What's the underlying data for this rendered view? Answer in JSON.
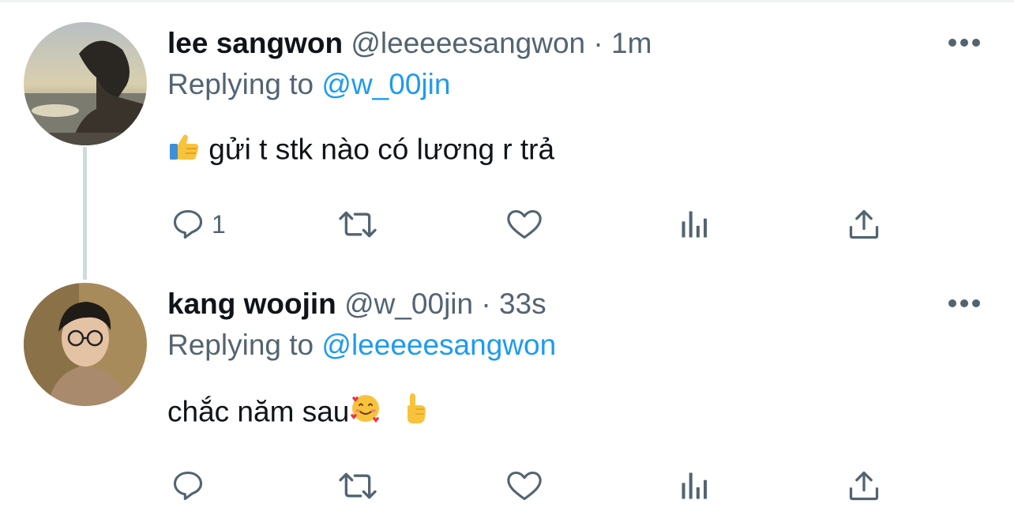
{
  "tweets": [
    {
      "name": "lee sangwon",
      "handle": "@leeeeesangwon",
      "separator": "·",
      "time": "1m",
      "replying_prefix": "Replying to",
      "replying_to": "@w_00jin",
      "text": "gửi t stk nào có lương r trả",
      "leading_emoji": "thumbs-up-icon",
      "reply_count": "1"
    },
    {
      "name": "kang woojin",
      "handle": "@w_00jin",
      "separator": "·",
      "time": "33s",
      "replying_prefix": "Replying to",
      "replying_to": "@leeeeesangwon",
      "text": "chắc năm sau",
      "trailing_emojis": [
        "smiling-face-with-hearts-icon",
        "index-pointing-up-icon"
      ],
      "reply_count": ""
    }
  ],
  "colors": {
    "text": "#0f1419",
    "secondary": "#536471",
    "accent": "#1d9bf0",
    "thread_line": "#cfd9de"
  },
  "icons": [
    "reply-icon",
    "retweet-icon",
    "like-icon",
    "views-icon",
    "share-icon",
    "more-icon"
  ]
}
